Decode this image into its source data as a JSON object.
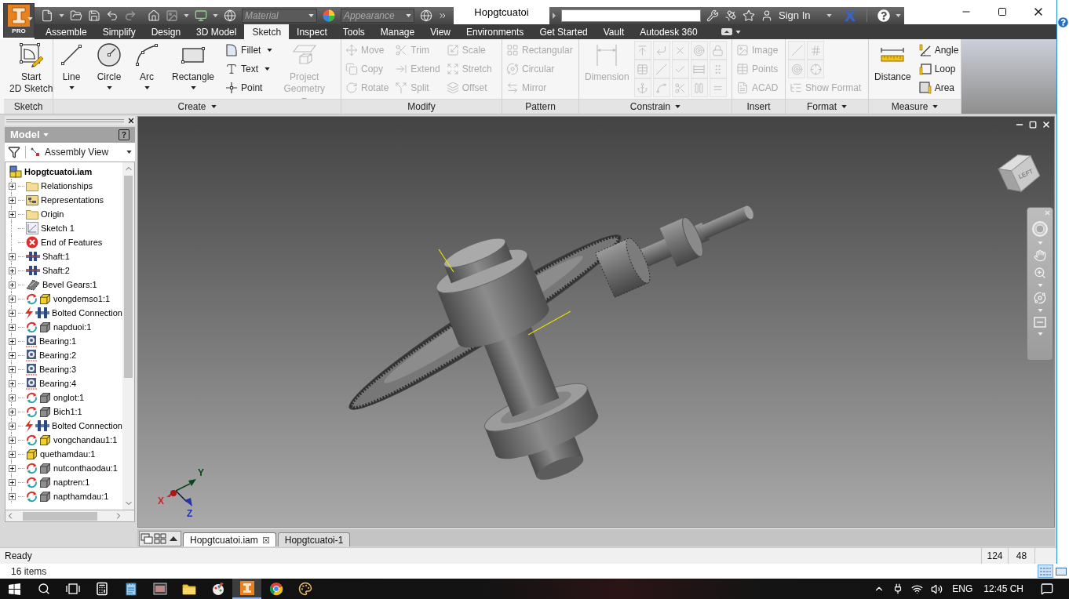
{
  "app_menu": {
    "badge": "PRO"
  },
  "quick_access": {
    "material": {
      "placeholder": "Material"
    },
    "appearance": {
      "placeholder": "Appearance"
    }
  },
  "window": {
    "title": "Hopgtcuatoi"
  },
  "account": {
    "sign_in": "Sign In"
  },
  "ribbon_tabs": [
    {
      "label": "Assemble",
      "selected": false
    },
    {
      "label": "Simplify",
      "selected": false
    },
    {
      "label": "Design",
      "selected": false
    },
    {
      "label": "3D Model",
      "selected": false
    },
    {
      "label": "Sketch",
      "selected": true
    },
    {
      "label": "Inspect",
      "selected": false
    },
    {
      "label": "Tools",
      "selected": false
    },
    {
      "label": "Manage",
      "selected": false
    },
    {
      "label": "View",
      "selected": false
    },
    {
      "label": "Environments",
      "selected": false
    },
    {
      "label": "Get Started",
      "selected": false
    },
    {
      "label": "Vault",
      "selected": false
    },
    {
      "label": "Autodesk 360",
      "selected": false
    }
  ],
  "ribbon_panels": [
    {
      "title": "Sketch",
      "menu": false,
      "columns": [
        {
          "kind": "large",
          "tools": [
            {
              "label": "Start\n2D Sketch",
              "disabled": false,
              "dropdown": false
            }
          ]
        }
      ]
    },
    {
      "title": "Create",
      "menu": true,
      "columns": [
        {
          "kind": "large",
          "tools": [
            {
              "label": "Line",
              "disabled": false,
              "dropdown": true
            }
          ]
        },
        {
          "kind": "large",
          "tools": [
            {
              "label": "Circle",
              "disabled": false,
              "dropdown": true
            }
          ]
        },
        {
          "kind": "large",
          "tools": [
            {
              "label": "Arc",
              "disabled": false,
              "dropdown": true
            }
          ]
        },
        {
          "kind": "large",
          "tools": [
            {
              "label": "Rectangle",
              "disabled": false,
              "dropdown": true
            }
          ]
        },
        {
          "kind": "stack",
          "tools": [
            {
              "label": "Fillet",
              "disabled": false,
              "dropdown": true
            },
            {
              "label": "Text",
              "disabled": false,
              "dropdown": true
            },
            {
              "label": "Point",
              "disabled": false,
              "dropdown": false
            }
          ]
        },
        {
          "kind": "large",
          "tools": [
            {
              "label": "Project\nGeometry",
              "disabled": true,
              "dropdown": true
            }
          ]
        }
      ]
    },
    {
      "title": "Modify",
      "menu": false,
      "columns": [
        {
          "kind": "stack",
          "tools": [
            {
              "label": "Move",
              "disabled": true,
              "dropdown": false
            },
            {
              "label": "Copy",
              "disabled": true,
              "dropdown": false
            },
            {
              "label": "Rotate",
              "disabled": true,
              "dropdown": false
            }
          ]
        },
        {
          "kind": "stack",
          "tools": [
            {
              "label": "Trim",
              "disabled": true,
              "dropdown": false
            },
            {
              "label": "Extend",
              "disabled": true,
              "dropdown": false
            },
            {
              "label": "Split",
              "disabled": true,
              "dropdown": false
            }
          ]
        },
        {
          "kind": "stack",
          "tools": [
            {
              "label": "Scale",
              "disabled": true,
              "dropdown": false
            },
            {
              "label": "Stretch",
              "disabled": true,
              "dropdown": false
            },
            {
              "label": "Offset",
              "disabled": true,
              "dropdown": false
            }
          ]
        }
      ]
    },
    {
      "title": "Pattern",
      "menu": false,
      "columns": [
        {
          "kind": "stack",
          "tools": [
            {
              "label": "Rectangular",
              "disabled": true,
              "dropdown": false
            },
            {
              "label": "Circular",
              "disabled": true,
              "dropdown": false
            },
            {
              "label": "Mirror",
              "disabled": true,
              "dropdown": false
            }
          ]
        }
      ]
    },
    {
      "title": "Constrain",
      "menu": true,
      "columns": [
        {
          "kind": "large",
          "tools": [
            {
              "label": "Dimension",
              "disabled": true,
              "dropdown": false
            }
          ]
        },
        {
          "kind": "icons",
          "tools": [
            {
              "disabled": true
            },
            {
              "disabled": true
            },
            {
              "disabled": true
            }
          ]
        },
        {
          "kind": "icons",
          "tools": [
            {
              "disabled": true
            },
            {
              "disabled": true
            },
            {
              "disabled": true
            }
          ]
        },
        {
          "kind": "icons",
          "tools": [
            {
              "disabled": true
            },
            {
              "disabled": true
            },
            {
              "disabled": true
            }
          ]
        },
        {
          "kind": "icons",
          "tools": [
            {
              "disabled": true
            },
            {
              "disabled": true
            },
            {
              "disabled": true
            }
          ]
        },
        {
          "kind": "icons",
          "tools": [
            {
              "disabled": true
            },
            {
              "disabled": true
            },
            {
              "disabled": true
            }
          ]
        }
      ]
    },
    {
      "title": "Insert",
      "menu": false,
      "columns": [
        {
          "kind": "stack",
          "tools": [
            {
              "label": "Image",
              "disabled": true,
              "dropdown": false
            },
            {
              "label": "Points",
              "disabled": true,
              "dropdown": false
            },
            {
              "label": "ACAD",
              "disabled": true,
              "dropdown": false
            }
          ]
        }
      ]
    },
    {
      "title": "Format",
      "menu": true,
      "columns": [
        {
          "kind": "grid",
          "tools": [
            {
              "kind": "icon",
              "disabled": true
            },
            {
              "kind": "icon",
              "disabled": true
            },
            {
              "kind": "icon",
              "disabled": true
            },
            {
              "kind": "icon",
              "disabled": true
            },
            {
              "kind": "small",
              "label": "Show Format",
              "disabled": true,
              "dropdown": false
            }
          ]
        }
      ]
    },
    {
      "title": "Measure",
      "menu": true,
      "columns": [
        {
          "kind": "large",
          "tools": [
            {
              "label": "Distance",
              "disabled": false,
              "dropdown": false
            }
          ]
        },
        {
          "kind": "stack",
          "tools": [
            {
              "label": "Angle",
              "disabled": false,
              "dropdown": false
            },
            {
              "label": "Loop",
              "disabled": false,
              "dropdown": false
            },
            {
              "label": "Area",
              "disabled": false,
              "dropdown": false
            }
          ]
        }
      ]
    }
  ],
  "browser": {
    "title": "Model",
    "view": "Assembly View",
    "root": {
      "label": "Hopgtcuatoi.iam",
      "children": [
        {
          "label": "Relationships",
          "kind": "folder",
          "expanded": false
        },
        {
          "label": "Representations",
          "kind": "representations",
          "expanded": false
        },
        {
          "label": "Origin",
          "kind": "folder",
          "expanded": false
        },
        {
          "label": "Sketch 1",
          "kind": "sketch"
        },
        {
          "label": "End of Features",
          "kind": "end"
        },
        {
          "label": "Shaft:1",
          "kind": "shaft",
          "expanded": false
        },
        {
          "label": "Shaft:2",
          "kind": "shaft",
          "expanded": false
        },
        {
          "label": "Bevel Gears:1",
          "kind": "bevel-gears",
          "expanded": false
        },
        {
          "label": "vongdemso1:1",
          "kind": "part",
          "color": "#f2cf2a",
          "cycle_badge": true,
          "expanded": false
        },
        {
          "label": "Bolted Connection",
          "kind": "bolted",
          "expanded": false
        },
        {
          "label": "napduoi:1",
          "kind": "part",
          "color": "#8e8e8e",
          "cycle_badge": true,
          "expanded": false
        },
        {
          "label": "Bearing:1",
          "kind": "bearing",
          "expanded": false
        },
        {
          "label": "Bearing:2",
          "kind": "bearing",
          "expanded": false
        },
        {
          "label": "Bearing:3",
          "kind": "bearing",
          "expanded": false
        },
        {
          "label": "Bearing:4",
          "kind": "bearing",
          "expanded": false
        },
        {
          "label": "onglot:1",
          "kind": "part",
          "color": "#8e8e8e",
          "cycle_badge": true,
          "expanded": false
        },
        {
          "label": "Bich1:1",
          "kind": "part",
          "color": "#8e8e8e",
          "cycle_badge": true,
          "expanded": false
        },
        {
          "label": "Bolted Connection",
          "kind": "bolted",
          "expanded": false
        },
        {
          "label": "vongchandau1:1",
          "kind": "part",
          "color": "#f2cf2a",
          "cycle_badge": true,
          "expanded": false
        },
        {
          "label": "quethamdau:1",
          "kind": "part",
          "color": "#f2cf2a",
          "cycle_badge": false,
          "expanded": false
        },
        {
          "label": "nutconthaodau:1",
          "kind": "part",
          "color": "#8e8e8e",
          "cycle_badge": true,
          "expanded": false
        },
        {
          "label": "naptren:1",
          "kind": "part",
          "color": "#8e8e8e",
          "cycle_badge": true,
          "expanded": false
        },
        {
          "label": "napthamdau:1",
          "kind": "part",
          "color": "#8e8e8e",
          "cycle_badge": true,
          "expanded": false
        }
      ]
    }
  },
  "viewport": {
    "view_cube": {
      "face": "LEFT"
    },
    "axes": [
      {
        "label": "X",
        "color": "#c82828"
      },
      {
        "label": "Y",
        "color": "#08471a"
      },
      {
        "label": "Z",
        "color": "#2233b0"
      }
    ]
  },
  "document_tabs": [
    {
      "label": "Hopgtcuatoi.iam",
      "selected": true,
      "closable": true
    },
    {
      "label": "Hopgtcuatoi-1",
      "selected": false,
      "closable": false
    }
  ],
  "status_bar": {
    "message": "Ready",
    "cells": [
      "124",
      "48"
    ]
  },
  "explorer": {
    "status": "16 items",
    "views": [
      {
        "kind": "details",
        "selected": true
      },
      {
        "kind": "tiles",
        "selected": false
      }
    ]
  },
  "taskbar": {
    "apps": [
      {
        "kind": "calculator",
        "selected": false
      },
      {
        "kind": "notepad",
        "selected": false
      },
      {
        "kind": "window",
        "selected": false
      },
      {
        "kind": "explorer",
        "selected": false
      },
      {
        "kind": "paint",
        "selected": false
      },
      {
        "kind": "inventor",
        "selected": true
      },
      {
        "kind": "browser",
        "selected": false
      },
      {
        "kind": "palette",
        "selected": false
      }
    ],
    "language": "ENG",
    "clock": "12:45 CH"
  }
}
